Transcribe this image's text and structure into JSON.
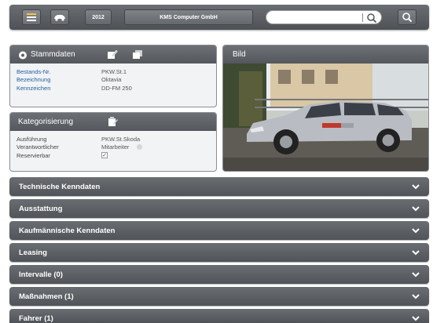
{
  "toolbar": {
    "home_icon": "list-icon",
    "car_icon": "car-icon",
    "year": "2012",
    "company": "KMS Computer GmbH",
    "search_value": "",
    "search_icon": "search-icon",
    "search_button_icon": "search-icon"
  },
  "stammdaten": {
    "title": "Stammdaten",
    "rows": [
      {
        "label": "Bestands-Nr.",
        "value": "PKW.St.1"
      },
      {
        "label": "Bezeichnung",
        "value": "Oktavia"
      },
      {
        "label": "Kennzeichen",
        "value": "DD-FM 250"
      }
    ]
  },
  "kategorisierung": {
    "title": "Kategorisierung",
    "rows": [
      {
        "label": "Ausführung",
        "value": "PKW.St.Skoda"
      },
      {
        "label": "Verantwortlicher",
        "value": "Mitarbeiter"
      },
      {
        "label": "Reservierbar",
        "value": "✓"
      }
    ]
  },
  "bild": {
    "title": "Bild",
    "car_color": "#b9bcc2",
    "sky_color": "#eef2f6",
    "ground_color": "#5f5b55"
  },
  "accordion": [
    {
      "label": "Technische Kenndaten"
    },
    {
      "label": "Ausstattung"
    },
    {
      "label": "Kaufmännische Kenndaten"
    },
    {
      "label": "Leasing"
    },
    {
      "label": "Intervalle (0)"
    },
    {
      "label": "Maßnahmen (1)"
    },
    {
      "label": "Fahrer (1)"
    }
  ],
  "colors": {
    "toolbar": "#55595d",
    "label_blue": "#1f5fa8",
    "panel_bg": "#f2f3f4"
  }
}
